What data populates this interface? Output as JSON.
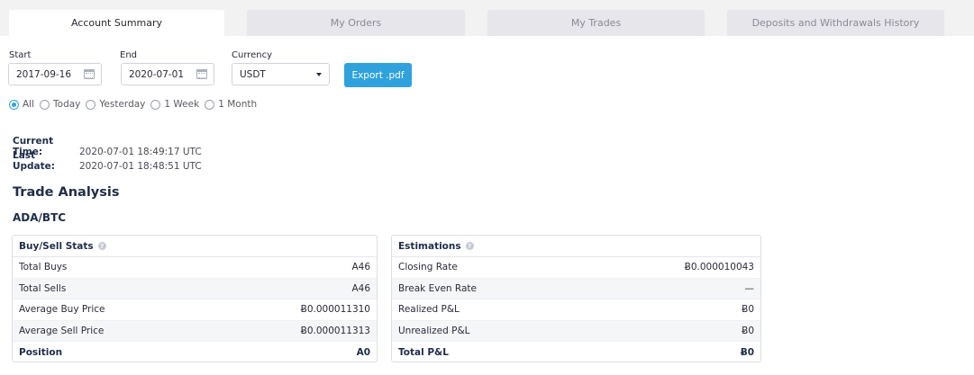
{
  "tabs": [
    {
      "label": "Account Summary",
      "active": true
    },
    {
      "label": "My Orders",
      "active": false
    },
    {
      "label": "My Trades",
      "active": false
    },
    {
      "label": "Deposits and Withdrawals History",
      "active": false
    }
  ],
  "filters": {
    "start_label": "Start",
    "start_value": "2017-09-16",
    "end_label": "End",
    "end_value": "2020-07-01",
    "currency_label": "Currency",
    "currency_value": "USDT",
    "export_label": "Export .pdf",
    "periods": [
      {
        "label": "All",
        "selected": true
      },
      {
        "label": "Today",
        "selected": false
      },
      {
        "label": "Yesterday",
        "selected": false
      },
      {
        "label": "1 Week",
        "selected": false
      },
      {
        "label": "1 Month",
        "selected": false
      }
    ]
  },
  "times": {
    "current_label": "Current Time:",
    "current_value": "2020-07-01 18:49:17 UTC",
    "update_label": "Last Update:",
    "update_value": "2020-07-01 18:48:51 UTC"
  },
  "analysis": {
    "title": "Trade Analysis",
    "pair": "ADA/BTC",
    "buy_sell": {
      "title": "Buy/Sell Stats",
      "rows": [
        {
          "label": "Total Buys",
          "value": "A46"
        },
        {
          "label": "Total Sells",
          "value": "A46"
        },
        {
          "label": "Average Buy Price",
          "value": "Ƀ0.000011310"
        },
        {
          "label": "Average Sell Price",
          "value": "Ƀ0.000011313"
        },
        {
          "label": "Position",
          "value": "A0"
        }
      ]
    },
    "estimations": {
      "title": "Estimations",
      "rows": [
        {
          "label": "Closing Rate",
          "value": "Ƀ0.000010043"
        },
        {
          "label": "Break Even Rate",
          "value": "—"
        },
        {
          "label": "Realized P&L",
          "value": "Ƀ0"
        },
        {
          "label": "Unrealized P&L",
          "value": "Ƀ0"
        },
        {
          "label": "Total P&L",
          "value": "Ƀ0"
        }
      ]
    }
  },
  "icons": {
    "calendar": "calendar-icon",
    "dropdown": "chevron-down-icon",
    "info": "info-icon"
  },
  "colors": {
    "accent": "#2fa2dd",
    "heading": "#1f2d4a"
  }
}
